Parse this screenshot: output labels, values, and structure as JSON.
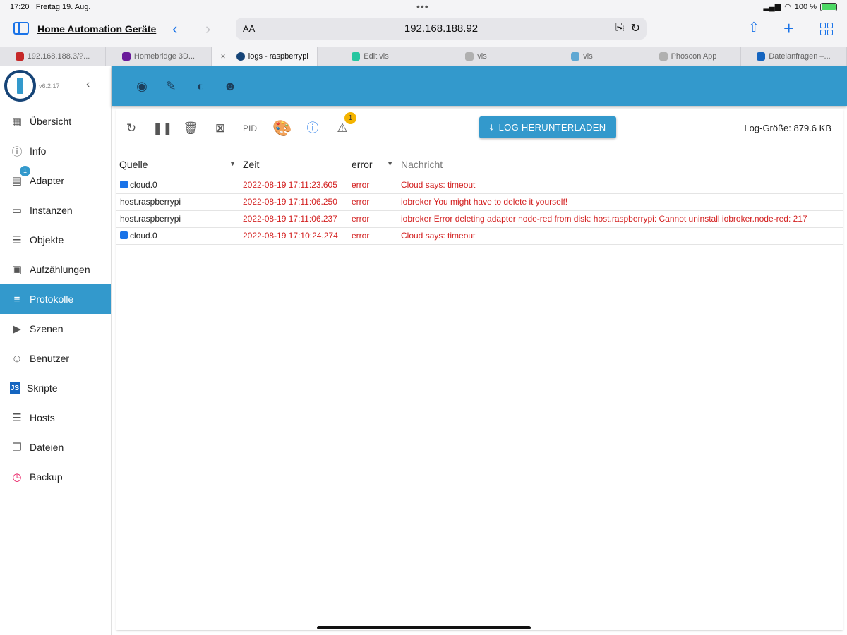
{
  "status": {
    "time": "17:20",
    "date": "Freitag 19. Aug.",
    "battery": "100 %"
  },
  "browser": {
    "site_title": "Home Automation Geräte",
    "address_aa": "AA",
    "url": "192.168.188.92",
    "tabs": [
      {
        "label": "192.168.188.3/?...",
        "color": "#c62828"
      },
      {
        "label": "Homebridge 3D...",
        "color": "#6a1b9a"
      },
      {
        "label": "logs - raspberrypi",
        "color": "#164477",
        "active": true
      },
      {
        "label": "Edit vis",
        "color": "#26c6a0"
      },
      {
        "label": "vis",
        "color": "#b0b0b0",
        "glyph": "1"
      },
      {
        "label": "vis",
        "color": "#5fa8d3"
      },
      {
        "label": "Phoscon App",
        "color": "#b0b0b0",
        "glyph": "P"
      },
      {
        "label": "Dateianfragen –...",
        "color": "#1565c0"
      }
    ]
  },
  "sidebar": {
    "version": "v6.2.17",
    "items": [
      {
        "label": "Übersicht",
        "icon": "apps-grid-icon"
      },
      {
        "label": "Info",
        "icon": "info-icon"
      },
      {
        "label": "Adapter",
        "icon": "adapter-store-icon",
        "badge": "1"
      },
      {
        "label": "Instanzen",
        "icon": "instances-icon"
      },
      {
        "label": "Objekte",
        "icon": "objects-list-icon"
      },
      {
        "label": "Aufzählungen",
        "icon": "enums-icon"
      },
      {
        "label": "Protokolle",
        "icon": "logs-icon",
        "active": true
      },
      {
        "label": "Szenen",
        "icon": "scenes-icon"
      },
      {
        "label": "Benutzer",
        "icon": "user-icon"
      },
      {
        "label": "Skripte",
        "icon": "javascript-icon"
      },
      {
        "label": "Hosts",
        "icon": "hosts-icon"
      },
      {
        "label": "Dateien",
        "icon": "files-icon"
      },
      {
        "label": "Backup",
        "icon": "backup-icon"
      }
    ]
  },
  "toolbar": {
    "pid_label": "PID",
    "warning_count": "1",
    "download_label": "LOG HERUNTERLADEN",
    "log_size": "Log-Größe: 879.6 KB"
  },
  "filters": {
    "source": "Quelle",
    "time": "Zeit",
    "severity": "error",
    "message": "Nachricht"
  },
  "log_rows": [
    {
      "source": "cloud.0",
      "cloud": true,
      "time": "2022-08-19 17:11:23.605",
      "severity": "error",
      "message": "Cloud says: timeout"
    },
    {
      "source": "host.raspberrypi",
      "cloud": false,
      "time": "2022-08-19 17:11:06.250",
      "severity": "error",
      "message": "iobroker You might have to delete it yourself!"
    },
    {
      "source": "host.raspberrypi",
      "cloud": false,
      "time": "2022-08-19 17:11:06.237",
      "severity": "error",
      "message": "iobroker Error deleting adapter node-red from disk: host.raspberrypi: Cannot uninstall iobroker.node-red: 217"
    },
    {
      "source": "cloud.0",
      "cloud": true,
      "time": "2022-08-19 17:10:24.274",
      "severity": "error",
      "message": "Cloud says: timeout"
    }
  ],
  "colors": {
    "accent": "#3399cc",
    "error": "#d32020",
    "logo_dark": "#164477"
  }
}
